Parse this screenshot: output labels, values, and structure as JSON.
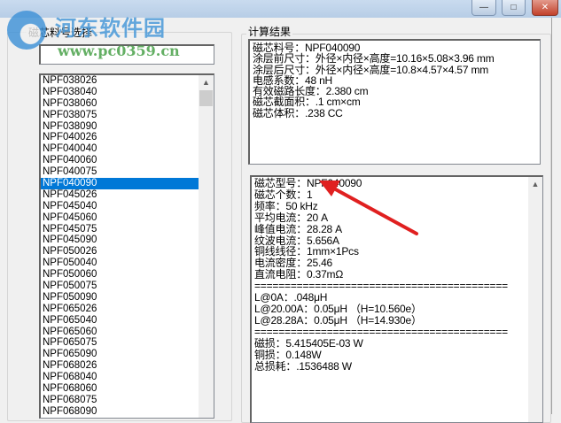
{
  "window": {
    "minimize": "—",
    "maximize": "□",
    "close": "✕"
  },
  "watermark": {
    "name": "河东软件园",
    "url": "www.pc0359.cn"
  },
  "left": {
    "group_label": "磁芯料号选择",
    "search_value": "",
    "items": [
      "NPF038026",
      "NPF038040",
      "NPF038060",
      "NPF038075",
      "NPF038090",
      "NPF040026",
      "NPF040040",
      "NPF040060",
      "NPF040075",
      "NPF040090",
      "NPF045026",
      "NPF045040",
      "NPF045060",
      "NPF045075",
      "NPF045090",
      "NPF050026",
      "NPF050040",
      "NPF050060",
      "NPF050075",
      "NPF050090",
      "NPF065026",
      "NPF065040",
      "NPF065060",
      "NPF065075",
      "NPF065090",
      "NPF068026",
      "NPF068040",
      "NPF068060",
      "NPF068075",
      "NPF068090"
    ],
    "selected": "NPF040090"
  },
  "right": {
    "group_label": "计算结果",
    "summary": "磁芯料号：NPF040090\n涂层前尺寸：外径×内径×高度=10.16×5.08×3.96 mm\n涂层后尺寸：外径×内径×高度=10.8×4.57×4.57 mm\n电感系数：48 nH\n有效磁路长度：2.380 cm\n磁芯截面积：.1 cm×cm\n磁芯体积：.238 CC",
    "details": "磁芯型号：NPF040090\n磁芯个数：1\n频率：50 kHz\n平均电流：20 A\n峰值电流：28.28 A\n纹波电流：5.656A\n铜线线径：1mm×1Pcs\n电流密度：25.46\n直流电阻：0.37mΩ\n==========================================\nL@0A：.048μH\nL@20.00A：0.05μH （H=10.560e）\nL@28.28A：0.05μH （H=14.930e）\n==========================================\n磁损：5.415405E-03 W\n铜损：0.148W\n总损耗：.1536488 W"
  },
  "colors": {
    "selection": "#0078d7",
    "arrow": "#e02020"
  }
}
